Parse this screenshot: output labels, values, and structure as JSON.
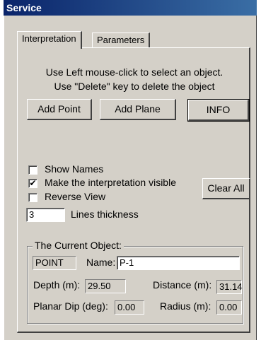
{
  "window": {
    "title": "Service"
  },
  "tabs": [
    {
      "label": "Interpretation",
      "active": true
    },
    {
      "label": "Parameters",
      "active": false
    }
  ],
  "instructions": {
    "line1": "Use Left mouse-click to select an object.",
    "line2": "Use \"Delete\" key to delete the object"
  },
  "buttons": {
    "add_point": "Add Point",
    "add_plane": "Add Plane",
    "info": "INFO",
    "clear_all": "Clear All"
  },
  "options": {
    "show_names": {
      "label": "Show Names",
      "checked": false
    },
    "make_visible": {
      "label": "Make the interpretation visible",
      "checked": true
    },
    "reverse_view": {
      "label": "Reverse View",
      "checked": false
    },
    "lines_thickness": {
      "label": "Lines thickness",
      "value": "3"
    }
  },
  "current_object": {
    "group_label": "The Current Object:",
    "type": "POINT",
    "name_label": "Name:",
    "name_value": "P-1",
    "depth_label": "Depth (m):",
    "depth_value": "29.50",
    "distance_label": "Distance (m):",
    "distance_value": "31.14",
    "dip_label": "Planar Dip (deg):",
    "dip_value": "0.00",
    "radius_label": "Radius (m):",
    "radius_value": "0.00"
  },
  "check_mark": "✔"
}
